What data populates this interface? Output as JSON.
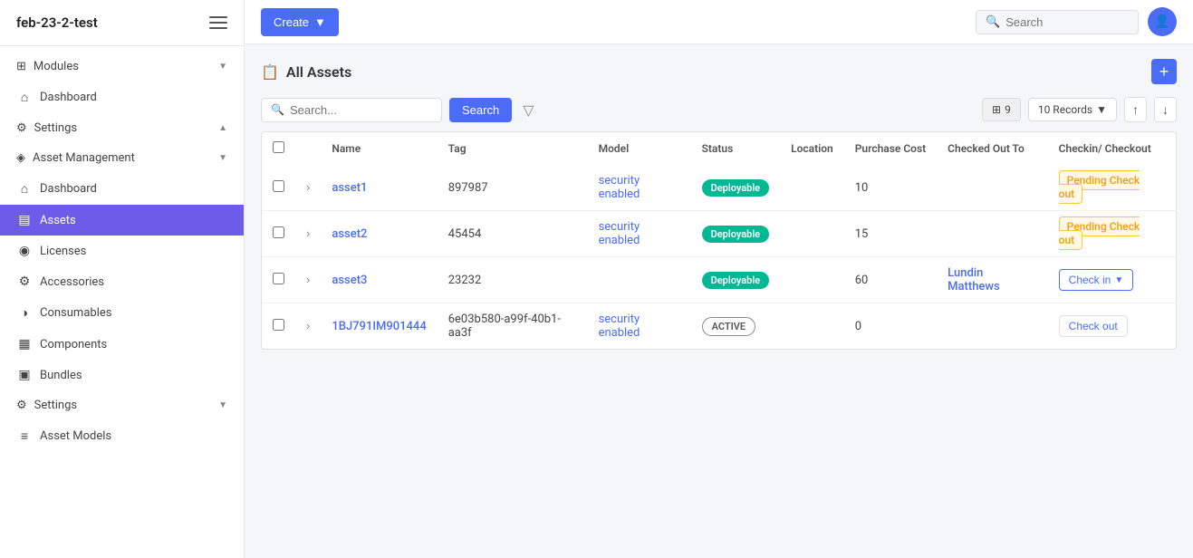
{
  "app": {
    "title": "feb-23-2-test",
    "user_icon": "👤"
  },
  "sidebar": {
    "modules_label": "Modules",
    "chevron_down": "▼",
    "chevron_up": "▲",
    "items": [
      {
        "id": "dashboard-top",
        "label": "Dashboard",
        "icon": "⌂"
      },
      {
        "id": "settings-top",
        "label": "Settings",
        "icon": "⚙",
        "chevron": "▲"
      },
      {
        "id": "asset-management",
        "label": "Asset Management",
        "icon": "◈",
        "chevron": "▼"
      },
      {
        "id": "dashboard-sub",
        "label": "Dashboard",
        "icon": "⌂"
      },
      {
        "id": "assets",
        "label": "Assets",
        "icon": "▤",
        "active": true
      },
      {
        "id": "licenses",
        "label": "Licenses",
        "icon": "◉"
      },
      {
        "id": "accessories",
        "label": "Accessories",
        "icon": "⚙"
      },
      {
        "id": "consumables",
        "label": "Consumables",
        "icon": "◑"
      },
      {
        "id": "components",
        "label": "Components",
        "icon": "▦"
      },
      {
        "id": "bundles",
        "label": "Bundles",
        "icon": "▣"
      },
      {
        "id": "settings-sub",
        "label": "Settings",
        "icon": "⚙",
        "chevron": "▼"
      },
      {
        "id": "asset-models",
        "label": "Asset Models",
        "icon": "≡"
      }
    ]
  },
  "toolbar": {
    "create_label": "Create",
    "create_arrow": "▼",
    "search_placeholder": "Search",
    "add_label": "+"
  },
  "page": {
    "title": "All Assets",
    "icon": "📋"
  },
  "table_toolbar": {
    "search_placeholder": "Search...",
    "search_btn": "Search",
    "filter_icon": "▼",
    "columns_icon": "⊞",
    "columns_count": "9",
    "records_label": "10 Records",
    "export_up": "↑",
    "export_down": "↓"
  },
  "table": {
    "columns": [
      "",
      "",
      "Name",
      "Tag",
      "Model",
      "Status",
      "Location",
      "Purchase Cost",
      "Checked Out To",
      "Checkin/Checkout"
    ],
    "rows": [
      {
        "id": "1",
        "name": "asset1",
        "tag": "897987",
        "model": "security enabled",
        "status": "Deployable",
        "status_type": "deployable",
        "location": "",
        "purchase_cost": "10",
        "checked_out_to": "",
        "action": "Pending Check out",
        "action_type": "pending"
      },
      {
        "id": "2",
        "name": "asset2",
        "tag": "45454",
        "model": "security enabled",
        "status": "Deployable",
        "status_type": "deployable",
        "location": "",
        "purchase_cost": "15",
        "checked_out_to": "",
        "action": "Pending Check out",
        "action_type": "pending"
      },
      {
        "id": "3",
        "name": "asset3",
        "tag": "23232",
        "model": "",
        "status": "Deployable",
        "status_type": "deployable",
        "location": "",
        "purchase_cost": "60",
        "checked_out_to": "Lundin Matthews",
        "action": "Check in",
        "action_type": "checkin"
      },
      {
        "id": "4",
        "name": "1BJ791IM901444",
        "tag": "6e03b580-a99f-40b1-aa3f",
        "model": "security enabled",
        "status": "ACTIVE",
        "status_type": "active",
        "location": "",
        "purchase_cost": "0",
        "checked_out_to": "",
        "action": "Check out",
        "action_type": "checkout"
      }
    ]
  }
}
